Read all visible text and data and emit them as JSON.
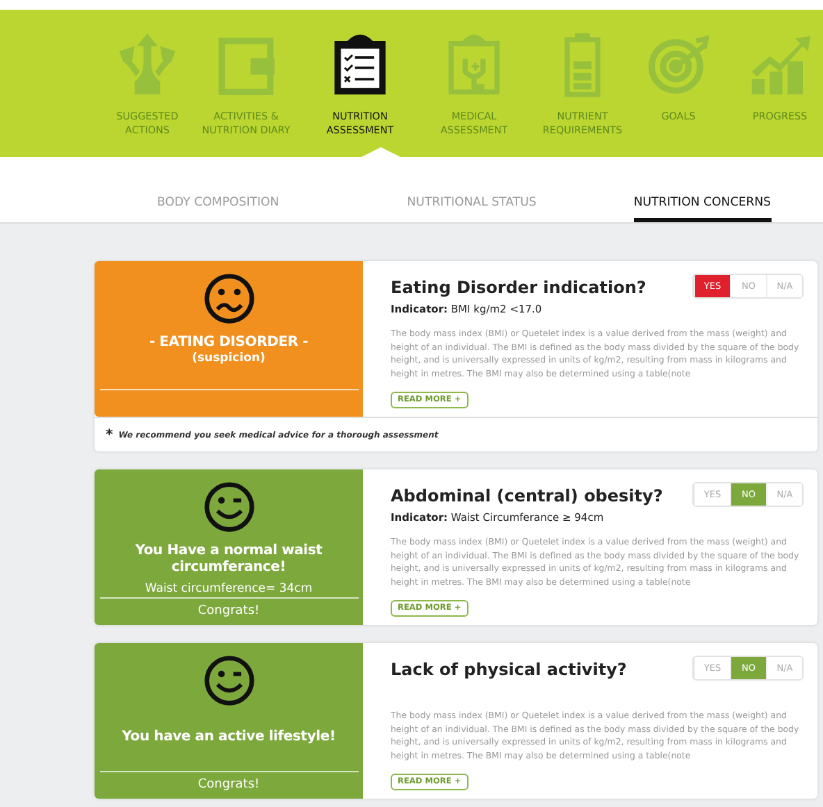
{
  "nav": [
    {
      "label": "SUGGESTED ACTIONS",
      "selected": false
    },
    {
      "label": "ACTIVITIES & NUTRITION DIARY",
      "selected": false
    },
    {
      "label": "NUTRITION ASSESSMENT",
      "selected": true
    },
    {
      "label": "MEDICAL ASSESSMENT",
      "selected": false
    },
    {
      "label": "NUTRIENT REQUIREMENTS",
      "selected": false
    },
    {
      "label": "GOALS",
      "selected": false
    },
    {
      "label": "PROGRESS",
      "selected": false
    }
  ],
  "subtabs": [
    {
      "label": "BODY COMPOSITION",
      "selected": false
    },
    {
      "label": "NUTRITIONAL STATUS",
      "selected": false
    },
    {
      "label": "NUTRITION CONCERNS",
      "selected": true
    }
  ],
  "concerns": [
    {
      "kind": "warning",
      "headline": "- EATING DISORDER -",
      "subline": "(suspicion)",
      "question": "Eating Disorder indication?",
      "indicator": "**Indicator:** BMI kg/m2 <17.0",
      "description": "The body mass index (BMI) or Quetelet index is a value derived from the mass (weight) and height of an individual. The BMI is defined as the body mass divided by the square of the body height, and is universally expressed in units of kg/m2, resulting from mass in kilograms and height in metres. The BMI may also be determined using a table(note",
      "read_more": "READ MORE +",
      "answers": [
        {
          "label": "YES",
          "selected": true
        },
        {
          "label": "NO",
          "selected": false
        },
        {
          "label": "N/A",
          "selected": false
        }
      ],
      "footnote_mark": "*",
      "footnote": "We recommend you seek medical advice for a thorough assessment"
    },
    {
      "kind": "ok",
      "headline": "You Have a normal waist circumferance!",
      "subline": "Waist circumference= 34cm",
      "footer": "Congrats!",
      "question": "Abdominal (central) obesity?",
      "indicator": "**Indicator:** Waist Circumferance ≥ 94cm",
      "description": "The body mass index (BMI) or Quetelet index is a value derived from the mass (weight) and height of an individual. The BMI is defined as the body mass divided by the square of the body height, and is universally expressed in units of kg/m2, resulting from mass in kilograms and height in metres. The BMI may also be determined using a table(note",
      "read_more": "READ MORE +",
      "answers": [
        {
          "label": "YES",
          "selected": false
        },
        {
          "label": "NO",
          "selected": true
        },
        {
          "label": "N/A",
          "selected": false
        }
      ]
    },
    {
      "kind": "ok",
      "headline": "You have an active lifestyle!",
      "footer": "Congrats!",
      "question": "Lack of physical activity?",
      "description": "The body mass index (BMI) or Quetelet index is a value derived from the mass (weight) and height of an individual. The BMI is defined as the body mass divided by the square of the body height, and is universally expressed in units of kg/m2, resulting from mass in kilograms and height in metres. The BMI may also be determined using a table(note",
      "read_more": "READ MORE +",
      "answers": [
        {
          "label": "YES",
          "selected": false
        },
        {
          "label": "NO",
          "selected": true
        },
        {
          "label": "N/A",
          "selected": false
        }
      ]
    }
  ]
}
